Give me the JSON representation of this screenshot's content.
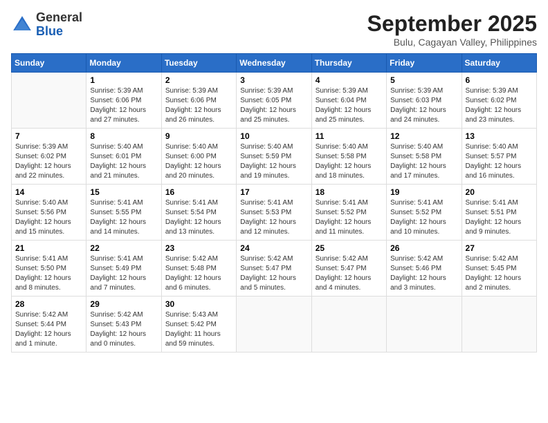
{
  "header": {
    "logo": {
      "line1": "General",
      "line2": "Blue"
    },
    "title": "September 2025",
    "location": "Bulu, Cagayan Valley, Philippines"
  },
  "weekdays": [
    "Sunday",
    "Monday",
    "Tuesday",
    "Wednesday",
    "Thursday",
    "Friday",
    "Saturday"
  ],
  "weeks": [
    [
      {
        "day": "",
        "info": ""
      },
      {
        "day": "1",
        "info": "Sunrise: 5:39 AM\nSunset: 6:06 PM\nDaylight: 12 hours\nand 27 minutes."
      },
      {
        "day": "2",
        "info": "Sunrise: 5:39 AM\nSunset: 6:06 PM\nDaylight: 12 hours\nand 26 minutes."
      },
      {
        "day": "3",
        "info": "Sunrise: 5:39 AM\nSunset: 6:05 PM\nDaylight: 12 hours\nand 25 minutes."
      },
      {
        "day": "4",
        "info": "Sunrise: 5:39 AM\nSunset: 6:04 PM\nDaylight: 12 hours\nand 25 minutes."
      },
      {
        "day": "5",
        "info": "Sunrise: 5:39 AM\nSunset: 6:03 PM\nDaylight: 12 hours\nand 24 minutes."
      },
      {
        "day": "6",
        "info": "Sunrise: 5:39 AM\nSunset: 6:02 PM\nDaylight: 12 hours\nand 23 minutes."
      }
    ],
    [
      {
        "day": "7",
        "info": "Sunrise: 5:39 AM\nSunset: 6:02 PM\nDaylight: 12 hours\nand 22 minutes."
      },
      {
        "day": "8",
        "info": "Sunrise: 5:40 AM\nSunset: 6:01 PM\nDaylight: 12 hours\nand 21 minutes."
      },
      {
        "day": "9",
        "info": "Sunrise: 5:40 AM\nSunset: 6:00 PM\nDaylight: 12 hours\nand 20 minutes."
      },
      {
        "day": "10",
        "info": "Sunrise: 5:40 AM\nSunset: 5:59 PM\nDaylight: 12 hours\nand 19 minutes."
      },
      {
        "day": "11",
        "info": "Sunrise: 5:40 AM\nSunset: 5:58 PM\nDaylight: 12 hours\nand 18 minutes."
      },
      {
        "day": "12",
        "info": "Sunrise: 5:40 AM\nSunset: 5:58 PM\nDaylight: 12 hours\nand 17 minutes."
      },
      {
        "day": "13",
        "info": "Sunrise: 5:40 AM\nSunset: 5:57 PM\nDaylight: 12 hours\nand 16 minutes."
      }
    ],
    [
      {
        "day": "14",
        "info": "Sunrise: 5:40 AM\nSunset: 5:56 PM\nDaylight: 12 hours\nand 15 minutes."
      },
      {
        "day": "15",
        "info": "Sunrise: 5:41 AM\nSunset: 5:55 PM\nDaylight: 12 hours\nand 14 minutes."
      },
      {
        "day": "16",
        "info": "Sunrise: 5:41 AM\nSunset: 5:54 PM\nDaylight: 12 hours\nand 13 minutes."
      },
      {
        "day": "17",
        "info": "Sunrise: 5:41 AM\nSunset: 5:53 PM\nDaylight: 12 hours\nand 12 minutes."
      },
      {
        "day": "18",
        "info": "Sunrise: 5:41 AM\nSunset: 5:52 PM\nDaylight: 12 hours\nand 11 minutes."
      },
      {
        "day": "19",
        "info": "Sunrise: 5:41 AM\nSunset: 5:52 PM\nDaylight: 12 hours\nand 10 minutes."
      },
      {
        "day": "20",
        "info": "Sunrise: 5:41 AM\nSunset: 5:51 PM\nDaylight: 12 hours\nand 9 minutes."
      }
    ],
    [
      {
        "day": "21",
        "info": "Sunrise: 5:41 AM\nSunset: 5:50 PM\nDaylight: 12 hours\nand 8 minutes."
      },
      {
        "day": "22",
        "info": "Sunrise: 5:41 AM\nSunset: 5:49 PM\nDaylight: 12 hours\nand 7 minutes."
      },
      {
        "day": "23",
        "info": "Sunrise: 5:42 AM\nSunset: 5:48 PM\nDaylight: 12 hours\nand 6 minutes."
      },
      {
        "day": "24",
        "info": "Sunrise: 5:42 AM\nSunset: 5:47 PM\nDaylight: 12 hours\nand 5 minutes."
      },
      {
        "day": "25",
        "info": "Sunrise: 5:42 AM\nSunset: 5:47 PM\nDaylight: 12 hours\nand 4 minutes."
      },
      {
        "day": "26",
        "info": "Sunrise: 5:42 AM\nSunset: 5:46 PM\nDaylight: 12 hours\nand 3 minutes."
      },
      {
        "day": "27",
        "info": "Sunrise: 5:42 AM\nSunset: 5:45 PM\nDaylight: 12 hours\nand 2 minutes."
      }
    ],
    [
      {
        "day": "28",
        "info": "Sunrise: 5:42 AM\nSunset: 5:44 PM\nDaylight: 12 hours\nand 1 minute."
      },
      {
        "day": "29",
        "info": "Sunrise: 5:42 AM\nSunset: 5:43 PM\nDaylight: 12 hours\nand 0 minutes."
      },
      {
        "day": "30",
        "info": "Sunrise: 5:43 AM\nSunset: 5:42 PM\nDaylight: 11 hours\nand 59 minutes."
      },
      {
        "day": "",
        "info": ""
      },
      {
        "day": "",
        "info": ""
      },
      {
        "day": "",
        "info": ""
      },
      {
        "day": "",
        "info": ""
      }
    ]
  ]
}
